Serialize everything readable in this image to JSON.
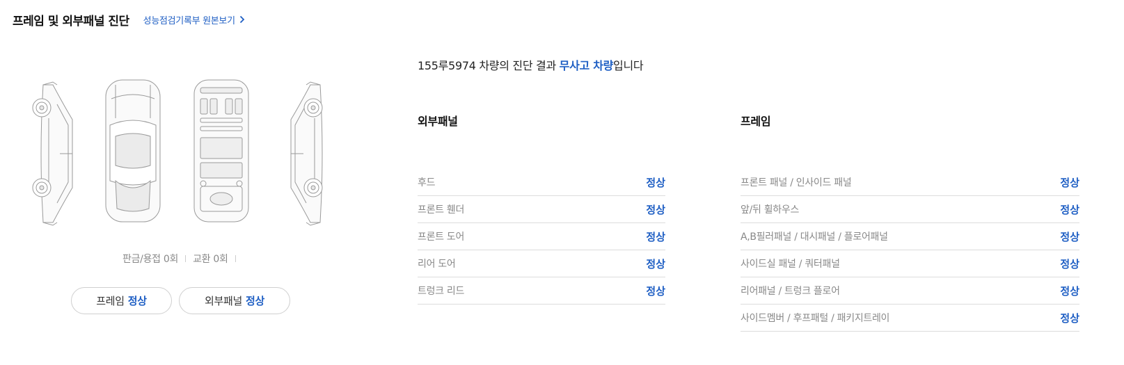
{
  "header": {
    "title": "프레임 및 외부패널 진단",
    "link_label": "성능점검기록부 원본보기"
  },
  "counts": {
    "repair": "판금/용접 0회",
    "replace": "교환 0회"
  },
  "pills": {
    "frame_label": "프레임",
    "frame_status": "정상",
    "outer_label": "외부패널",
    "outer_status": "정상"
  },
  "summary": {
    "prefix": "155루5974 차량의 진단 결과 ",
    "highlight": "무사고 차량",
    "suffix": "입니다"
  },
  "outer_panel": {
    "title": "외부패널",
    "items": [
      {
        "name": "후드",
        "status": "정상"
      },
      {
        "name": "프론트 휀더",
        "status": "정상"
      },
      {
        "name": "프론트 도어",
        "status": "정상"
      },
      {
        "name": "리어 도어",
        "status": "정상"
      },
      {
        "name": "트렁크 리드",
        "status": "정상"
      }
    ]
  },
  "frame": {
    "title": "프레임",
    "items": [
      {
        "name": "프론트 패널 / 인사이드 패널",
        "status": "정상"
      },
      {
        "name": "앞/뒤 휠하우스",
        "status": "정상"
      },
      {
        "name": "A,B필러패널 / 대시패널 / 플로어패널",
        "status": "정상"
      },
      {
        "name": "사이드실 패널 / 쿼터패널",
        "status": "정상"
      },
      {
        "name": "리어패널 / 트렁크 플로어",
        "status": "정상"
      },
      {
        "name": "사이드멤버 / 후프패털 / 패키지트레이",
        "status": "정상"
      }
    ]
  },
  "colors": {
    "accent": "#1f5fc4",
    "muted_text": "#888888",
    "divider": "#dcdcdc"
  }
}
